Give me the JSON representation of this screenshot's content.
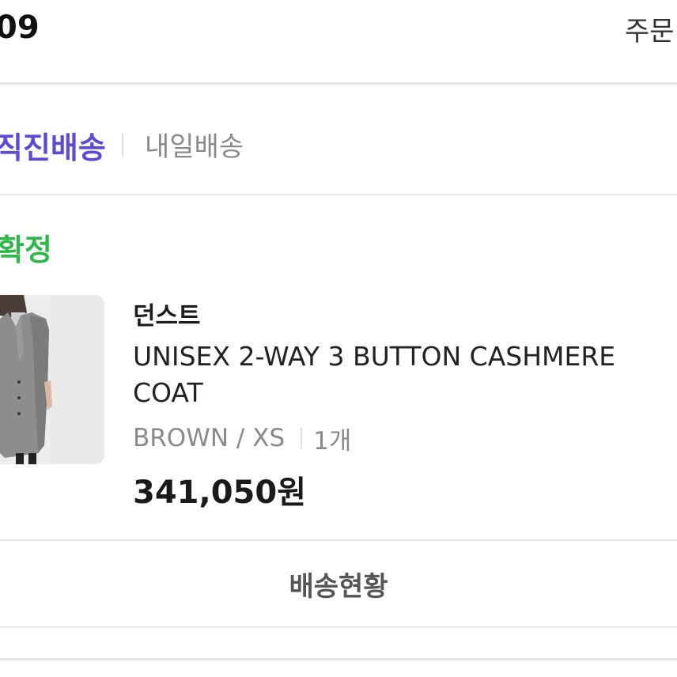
{
  "header": {
    "order_date": "09",
    "order_detail_label": "주문"
  },
  "delivery": {
    "direct_label": "직진배송",
    "tomorrow_label": "내일배송"
  },
  "order": {
    "status": "확정"
  },
  "product": {
    "brand": "던스트",
    "name": "UNISEX 2-WAY 3 BUTTON CASHMERE COAT",
    "option": "BROWN / XS",
    "quantity": "1개",
    "price": "341,050원"
  },
  "actions": {
    "delivery_status_label": "배송현황"
  },
  "colors": {
    "delivery_accent": "#5b4bd6",
    "status_green": "#2fb84a"
  }
}
